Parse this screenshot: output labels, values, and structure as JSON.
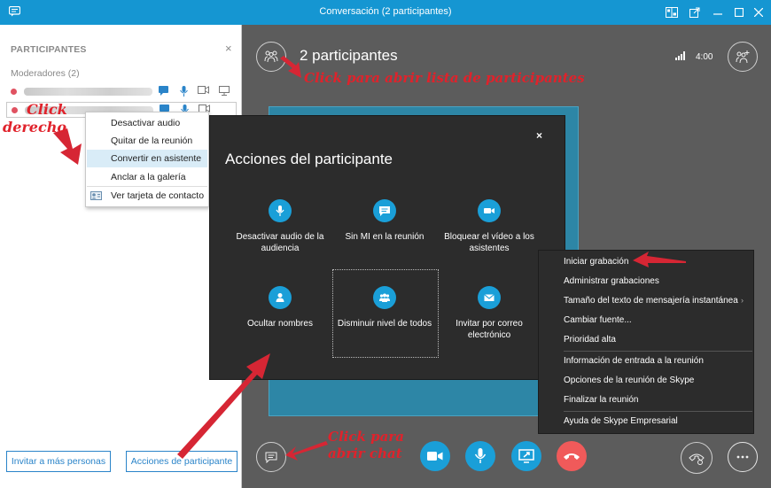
{
  "window": {
    "title": "Conversación (2 participantes)"
  },
  "left_panel": {
    "heading": "PARTICIPANTES",
    "close_glyph": "×",
    "group_label": "Moderadores (2)",
    "buttons": {
      "invite": "Invitar a más personas",
      "actions": "Acciones de participante"
    }
  },
  "context_menu": {
    "items": [
      "Desactivar audio",
      "Quitar de la reunión",
      "Convertir en asistente",
      "Anclar a la galería",
      "Ver tarjeta de contacto"
    ]
  },
  "stage": {
    "participants_title": "2 participantes",
    "timer": "4:00"
  },
  "dialog": {
    "title": "Acciones del participante",
    "close_glyph": "×",
    "actions": [
      {
        "label": "Desactivar audio de la audiencia",
        "icon": "microphone-icon"
      },
      {
        "label": "Sin MI en la reunión",
        "icon": "chat-bubble-icon"
      },
      {
        "label": "Bloquear el vídeo a los asistentes",
        "icon": "video-camera-icon"
      },
      {
        "label": "Ocultar nombres",
        "icon": "person-icon"
      },
      {
        "label": "Disminuir nivel de todos",
        "icon": "group-icon"
      },
      {
        "label": "Invitar por correo electrónico",
        "icon": "envelope-icon"
      }
    ]
  },
  "more_menu": {
    "items": [
      "Iniciar grabación",
      "Administrar grabaciones",
      "Tamaño del texto de mensajería instantánea",
      "Cambiar fuente...",
      "Prioridad alta",
      "Información de entrada a la reunión",
      "Opciones de la reunión de Skype",
      "Finalizar la reunión",
      "Ayuda de Skype Empresarial"
    ]
  },
  "annotations": {
    "right_click_line1": "Click",
    "right_click_line2": "derecho",
    "open_participants": "Click para abrir lista de participantes",
    "open_chat_line1": "Click para",
    "open_chat_line2": "abrir chat"
  },
  "colors": {
    "titlebar": "#1596d2",
    "accent": "#1a9fd8",
    "hangup": "#f05a5a",
    "annotation": "#e0222b"
  }
}
